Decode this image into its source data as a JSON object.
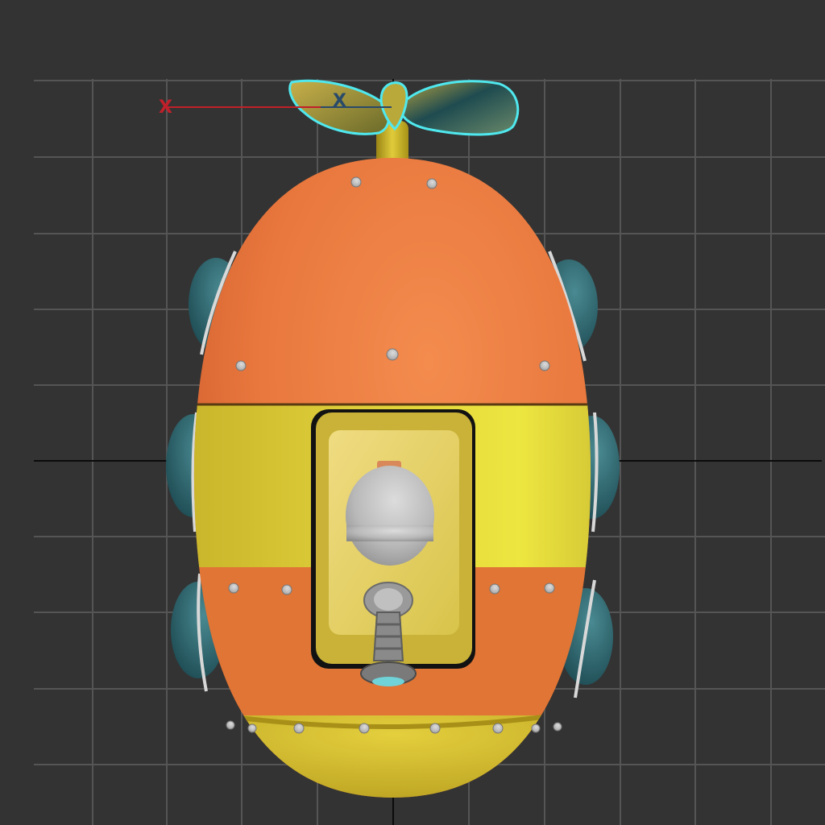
{
  "viewport": {
    "background": "#333333",
    "grid_color": "#555555",
    "axis_line_color": "#0b0b0b",
    "selection_outline_color": "#4fe8ee"
  },
  "gizmo": {
    "world_x_label": "X",
    "world_x_color": "#c0202a",
    "pivot_x_label": "X",
    "pivot_x_color": "#2a4a6a"
  },
  "model": {
    "body_orange": "#e8773d",
    "band_yellow": "#e0d03a",
    "porthole_teal": "#2f6a72",
    "rivet_grey": "#cfcfcf",
    "propeller_selected": true
  }
}
